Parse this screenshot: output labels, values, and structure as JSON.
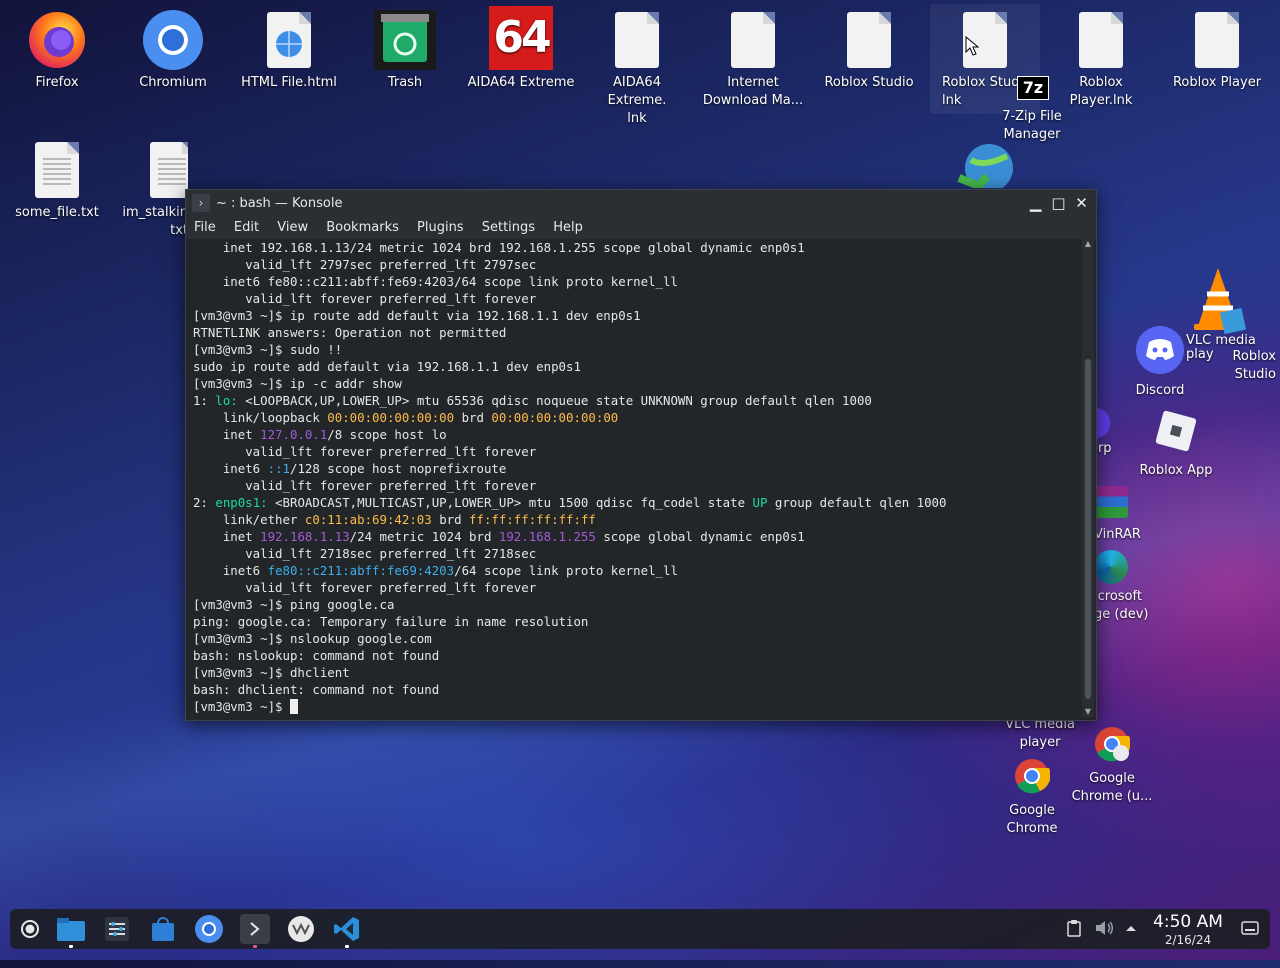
{
  "desktop": {
    "icons": [
      {
        "label": "Firefox",
        "icon": "firefox-icon"
      },
      {
        "label": "Chromium",
        "icon": "chromium-icon"
      },
      {
        "label": "HTML File.html",
        "icon": "html-file-icon"
      },
      {
        "label": "Trash",
        "icon": "trash-icon"
      },
      {
        "label": "AIDA64 Extreme",
        "icon": "aida64-icon",
        "glyph": "64"
      },
      {
        "label": "AIDA64 Extreme.\nlnk",
        "icon": "file-icon"
      },
      {
        "label": "Internet\nDownload Ma...",
        "icon": "file-icon"
      },
      {
        "label": "Roblox Studio",
        "icon": "file-icon"
      },
      {
        "label": "Roblox Stud\nlnk",
        "icon": "file-icon"
      },
      {
        "label": "Roblox Player.lnk",
        "icon": "file-icon"
      },
      {
        "label": "Roblox Player",
        "icon": "file-icon"
      },
      {
        "label": "7-Zip File\nManager",
        "icon": "7zip-icon",
        "glyph": "7z"
      },
      {
        "label": "some_file.txt",
        "icon": "text-file-icon"
      },
      {
        "label": "im_stalkin\ntxt",
        "icon": "text-file-icon"
      },
      {
        "label": "VLC media\nplay",
        "icon": "vlc-icon"
      },
      {
        "label": "Roblox\nStudio",
        "icon": "roblox-studio-icon"
      },
      {
        "label": "Discord",
        "icon": "discord-icon"
      },
      {
        "label": "orp",
        "icon": "app-icon"
      },
      {
        "label": "Roblox App",
        "icon": "roblox-app-icon"
      },
      {
        "label": "VinRAR",
        "icon": "winrar-icon"
      },
      {
        "label": "icrosoft\nge (dev)",
        "icon": "edge-dev-icon"
      },
      {
        "label": "VLC media\nplayer",
        "icon": "vlc-icon"
      },
      {
        "label": "Google\nChrome",
        "icon": "google-chrome-icon"
      },
      {
        "label": "Google\nChrome (u...",
        "icon": "google-chrome-user-icon"
      }
    ]
  },
  "konsole": {
    "title": "~ : bash — Konsole",
    "menu": [
      "File",
      "Edit",
      "View",
      "Bookmarks",
      "Plugins",
      "Settings",
      "Help"
    ],
    "lines": [
      [
        {
          "t": "    inet 192.168.1.13/24 metric 1024 brd 192.168.1.255 scope global dynamic enp0s1"
        }
      ],
      [
        {
          "t": "       valid_lft 2797sec preferred_lft 2797sec"
        }
      ],
      [
        {
          "t": "    inet6 fe80::c211:abff:fe69:4203/64 scope link proto kernel_ll"
        }
      ],
      [
        {
          "t": "       valid_lft forever preferred_lft forever"
        }
      ],
      [
        {
          "t": "[vm3@vm3 ~]$ ip route add default via 192.168.1.1 dev enp0s1"
        }
      ],
      [
        {
          "t": "RTNETLINK answers: Operation not permitted"
        }
      ],
      [
        {
          "t": "[vm3@vm3 ~]$ sudo !!"
        }
      ],
      [
        {
          "t": "sudo ip route add default via 192.168.1.1 dev enp0s1"
        }
      ],
      [
        {
          "t": "[vm3@vm3 ~]$ ip -c addr show"
        }
      ],
      [
        {
          "t": "1: "
        },
        {
          "t": "lo:",
          "c": "grn"
        },
        {
          "t": " <LOOPBACK,UP,LOWER_UP> mtu 65536 qdisc noqueue state UNKNOWN group default qlen 1000"
        }
      ],
      [
        {
          "t": "    link/loopback "
        },
        {
          "t": "00:00:00:00:00:00",
          "c": "yel"
        },
        {
          "t": " brd "
        },
        {
          "t": "00:00:00:00:00:00",
          "c": "yel"
        }
      ],
      [
        {
          "t": "    inet "
        },
        {
          "t": "127.0.0.1",
          "c": "pur"
        },
        {
          "t": "/8 scope host lo"
        }
      ],
      [
        {
          "t": "       valid_lft forever preferred_lft forever"
        }
      ],
      [
        {
          "t": "    inet6 "
        },
        {
          "t": "::1",
          "c": "blu"
        },
        {
          "t": "/128 scope host noprefixroute"
        }
      ],
      [
        {
          "t": "       valid_lft forever preferred_lft forever"
        }
      ],
      [
        {
          "t": "2: "
        },
        {
          "t": "enp0s1:",
          "c": "grn"
        },
        {
          "t": " <BROADCAST,MULTICAST,UP,LOWER_UP> mtu 1500 qdisc fq_codel state "
        },
        {
          "t": "UP",
          "c": "grn"
        },
        {
          "t": " group default qlen 1000"
        }
      ],
      [
        {
          "t": "    link/ether "
        },
        {
          "t": "c0:11:ab:69:42:03",
          "c": "yel"
        },
        {
          "t": " brd "
        },
        {
          "t": "ff:ff:ff:ff:ff:ff",
          "c": "yel"
        }
      ],
      [
        {
          "t": "    inet "
        },
        {
          "t": "192.168.1.13",
          "c": "pur"
        },
        {
          "t": "/24 metric 1024 brd "
        },
        {
          "t": "192.168.1.255",
          "c": "pur"
        },
        {
          "t": " scope global dynamic enp0s1"
        }
      ],
      [
        {
          "t": "       valid_lft 2718sec preferred_lft 2718sec"
        }
      ],
      [
        {
          "t": "    inet6 "
        },
        {
          "t": "fe80::c211:abff:fe69:4203",
          "c": "blu"
        },
        {
          "t": "/64 scope link proto kernel_ll"
        }
      ],
      [
        {
          "t": "       valid_lft forever preferred_lft forever"
        }
      ],
      [
        {
          "t": "[vm3@vm3 ~]$ ping google.ca"
        }
      ],
      [
        {
          "t": "ping: google.ca: Temporary failure in name resolution"
        }
      ],
      [
        {
          "t": "[vm3@vm3 ~]$ nslookup google.com"
        }
      ],
      [
        {
          "t": "bash: nslookup: command not found"
        }
      ],
      [
        {
          "t": "[vm3@vm3 ~]$ dhclient"
        }
      ],
      [
        {
          "t": "bash: dhclient: command not found"
        }
      ],
      [
        {
          "t": "[vm3@vm3 ~]$ "
        }
      ]
    ],
    "colors": {
      "grn": "#1cdc9a",
      "yel": "#fdbc4b",
      "pur": "#a35bd4",
      "blu": "#3daee9"
    }
  },
  "taskbar": {
    "apps": [
      "application-launcher-icon",
      "file-manager-icon",
      "settings-icon",
      "discover-store-icon",
      "chromium-icon",
      "konsole-icon",
      "vmware-icon",
      "vscode-icon"
    ],
    "tray": [
      "clipboard-icon",
      "volume-icon",
      "tray-expand-icon",
      "show-desktop-icon"
    ],
    "clock": {
      "time": "4:50 AM",
      "date": "2/16/24"
    }
  }
}
